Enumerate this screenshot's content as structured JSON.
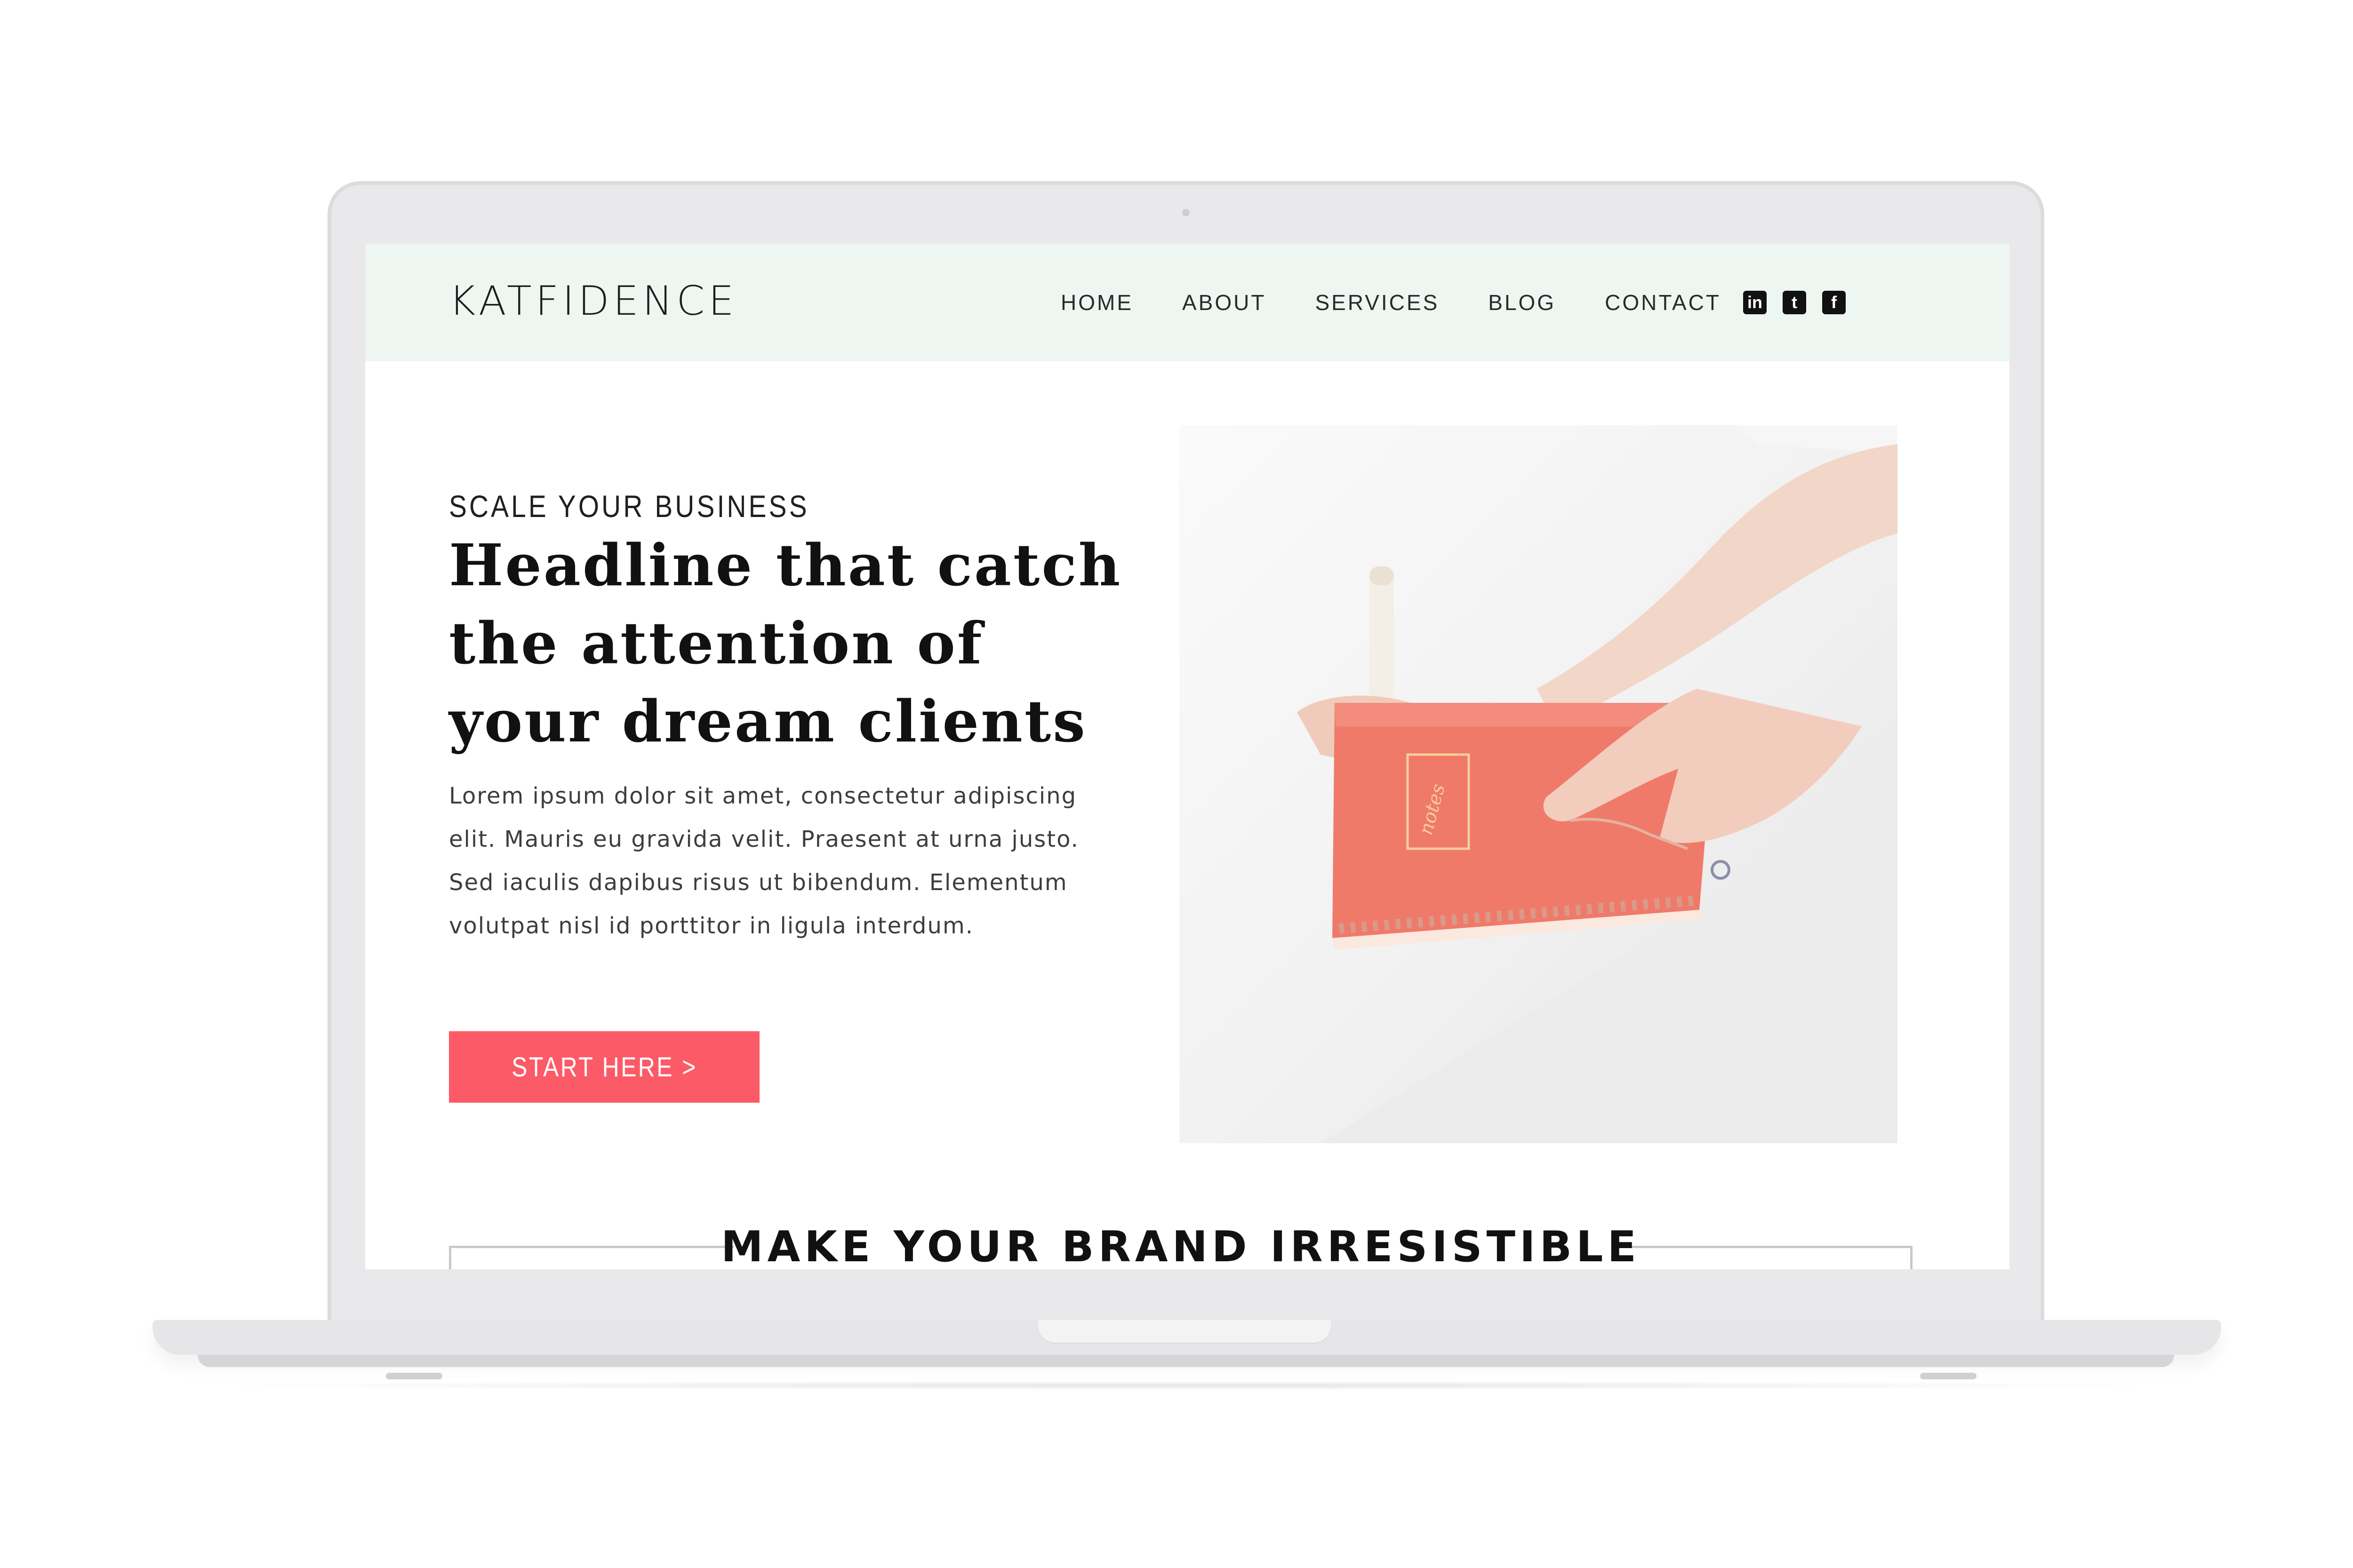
{
  "header": {
    "logo": "KATFIDENCE",
    "nav": [
      "HOME",
      "ABOUT",
      "SERVICES",
      "BLOG",
      "CONTACT"
    ],
    "socials": [
      {
        "icon": "linkedin-icon",
        "glyph": "in"
      },
      {
        "icon": "tumblr-icon",
        "glyph": "t"
      },
      {
        "icon": "facebook-icon",
        "glyph": "f"
      }
    ]
  },
  "hero": {
    "eyebrow": "SCALE YOUR BUSINESS",
    "headline": "Headline that catch the attention of your dream clients",
    "body": "Lorem ipsum dolor sit amet, consectetur adipiscing elit. Mauris eu gravida velit. Praesent at urna justo. Sed iaculis dapibus risus ut bibendum. Elementum volutpat nisl id porttitor in ligula interdum.",
    "cta": "START HERE >",
    "photo_notebook_text": "notes"
  },
  "section": {
    "title": "MAKE YOUR BRAND IRRESISTIBLE"
  },
  "colors": {
    "header_bg": "#eef6f1",
    "accent": "#fd5a67",
    "notebook": "#f07a6a"
  }
}
